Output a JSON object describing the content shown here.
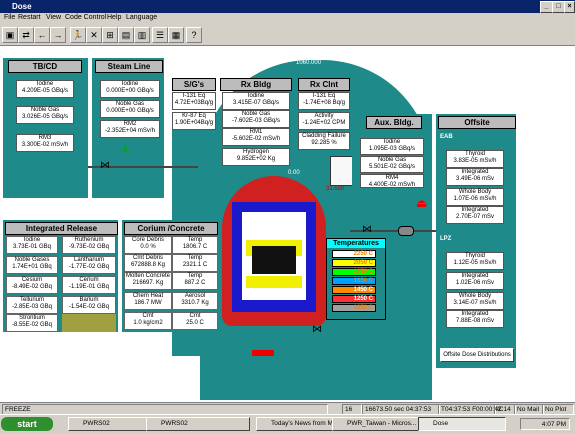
{
  "window": {
    "title": "Dose"
  },
  "menu": [
    "File",
    "Restart",
    "View",
    "Code Control",
    "Help",
    "Language"
  ],
  "diagram": {
    "top_value": "1060.000",
    "temp_value": "0.00",
    "tank_value": "31.590",
    "tbcd": {
      "title": "TB/CD",
      "items": [
        {
          "label": "Iodine",
          "value": "4.209E-05",
          "unit": "GBq/s"
        },
        {
          "label": "Noble Gas",
          "value": "3.026E-05",
          "unit": "GBq/s"
        },
        {
          "label": "RM3",
          "value": "3.300E-02",
          "unit": "mSv/h"
        }
      ]
    },
    "steam": {
      "title": "Steam Line",
      "items": [
        {
          "label": "Iodine",
          "value": "0.000E+00",
          "unit": "GBq/s"
        },
        {
          "label": "Noble Gas",
          "value": "0.000E+00",
          "unit": "GBq/s"
        },
        {
          "label": "RM2",
          "value": "-2.352E+04",
          "unit": "mSv/h"
        }
      ]
    },
    "sgs": {
      "title": "S/G's",
      "items": [
        {
          "label": "I-131 Eq",
          "value": "4.72E+03",
          "unit": "Bq/g"
        },
        {
          "label": "Kr-87 Eq",
          "value": "1.90E+04",
          "unit": "Bq/g"
        }
      ]
    },
    "rxbldg": {
      "title": "Rx Bldg",
      "items": [
        {
          "label": "Iodine",
          "value": "3.415E-07",
          "unit": "GBq/s"
        },
        {
          "label": "Noble Gas",
          "value": "-7.602E-03",
          "unit": "GBq/s"
        },
        {
          "label": "RM1",
          "value": "-5.602E-02",
          "unit": "mSv/h"
        },
        {
          "label": "Hydrogen",
          "value": "9.852E+02",
          "unit": "Kg"
        }
      ]
    },
    "rxclnt": {
      "title": "Rx Clnt",
      "items": [
        {
          "label": "I-131 Eq",
          "value": "-1.74E+08",
          "unit": "Bq/g"
        },
        {
          "label": "Activity",
          "value": "-1.24E+02",
          "unit": "CPM"
        },
        {
          "label": "Cladding Failure",
          "value": "92.285",
          "unit": "%"
        }
      ]
    },
    "aux": {
      "title": "Aux. Bldg.",
      "items": [
        {
          "label": "Iodine",
          "value": "1.095E-03",
          "unit": "GBq/s"
        },
        {
          "label": "Noble Gas",
          "value": "5.501E-02",
          "unit": "GBq/s"
        },
        {
          "label": "RM4",
          "value": "4.400E-02",
          "unit": "mSv/h"
        }
      ]
    },
    "offsite": {
      "title": "Offsite",
      "eab_label": "EAB",
      "lpz_label": "LPZ",
      "eab": [
        {
          "label": "Thyroid",
          "value": "3.83E-05",
          "unit": "mSv/h"
        },
        {
          "label": "Integrated",
          "value": "3.49E-06",
          "unit": "mSv"
        },
        {
          "label": "Whole Body",
          "value": "1.07E-06",
          "unit": "mSv/h"
        },
        {
          "label": "Integrated",
          "value": "2.70E-07",
          "unit": "mSv"
        }
      ],
      "lpz": [
        {
          "label": "Thyroid",
          "value": "1.12E-05",
          "unit": "mSv/h"
        },
        {
          "label": "Integrated",
          "value": "1.02E-06",
          "unit": "mSv"
        },
        {
          "label": "Whole Body",
          "value": "3.14E-07",
          "unit": "mSv/h"
        },
        {
          "label": "Integrated",
          "value": "7.88E-08",
          "unit": "mSv"
        }
      ],
      "distributions_button": "Offsite Dose Distributions"
    },
    "integrated": {
      "title": "Integrated Release",
      "items": [
        {
          "label": "Iodine",
          "value": "3.73E-01",
          "unit": "GBq"
        },
        {
          "label": "Ruthenium",
          "value": "-9.73E-02",
          "unit": "GBq"
        },
        {
          "label": "Noble Gases",
          "value": "1.74E+01",
          "unit": "GBq"
        },
        {
          "label": "Lanthanum",
          "value": "-1.77E-02",
          "unit": "GBq"
        },
        {
          "label": "Cesium",
          "value": "-8.49E-02",
          "unit": "GBq"
        },
        {
          "label": "Cerium",
          "value": "-1.19E-01",
          "unit": "GBq"
        },
        {
          "label": "Tellurium",
          "value": "-2.85E-03",
          "unit": "GBq"
        },
        {
          "label": "Barium",
          "value": "-1.54E-02",
          "unit": "GBq"
        },
        {
          "label": "Strontium",
          "value": "-8.55E-02",
          "unit": "GBq"
        }
      ]
    },
    "corium": {
      "title": "Corium /Concrete",
      "items": [
        {
          "label": "Core Debris",
          "value": "0.0",
          "unit": "%"
        },
        {
          "label": "Temp",
          "value": "1806.7",
          "unit": "C"
        },
        {
          "label": "Cmt Debris",
          "value": "672888.8",
          "unit": "Kg"
        },
        {
          "label": "Temp",
          "value": "2321.1",
          "unit": "C"
        },
        {
          "label": "Molten Concrete",
          "value": "216697.",
          "unit": "Kg"
        },
        {
          "label": "Temp",
          "value": "887.2",
          "unit": "C"
        },
        {
          "label": "Chem Heat",
          "value": "186.7",
          "unit": "MW"
        },
        {
          "label": "Aerosol",
          "value": "3310.7",
          "unit": "Kg"
        },
        {
          "label": "Cmt",
          "value": "1.0",
          "unit": "kg/cm2"
        },
        {
          "label": "Cmt",
          "value": "25.0",
          "unit": "C"
        }
      ]
    },
    "temps": {
      "title": "Temperatures",
      "rows": [
        {
          "value": "2250 C",
          "color": "#ffffff"
        },
        {
          "value": "2050 C",
          "color": "#ffff00"
        },
        {
          "value": "1850 C",
          "color": "#00ff00"
        },
        {
          "value": "1650 C",
          "color": "#00a0ff"
        },
        {
          "value": "1450 C",
          "color": "#ff8c00"
        },
        {
          "value": "1250 C",
          "color": "#ff3030"
        },
        {
          "value": "1050 C",
          "color": "#a0a0a0"
        }
      ]
    }
  },
  "status": {
    "mode": "FREEZE",
    "num": "16",
    "sim_time": "16673.50 sec 04:37:53",
    "clock": "T04:37:53 F00:00:42",
    "cell": "IC14",
    "mail": "No Mail",
    "plot": "No Plot"
  },
  "taskbar": {
    "start": "start",
    "tasks": [
      "PWRS02",
      "PWRS02",
      "Today's News from M...",
      "PWR_Taiwan - Micros...",
      "Dose"
    ],
    "time": "4:07 PM"
  },
  "colors": {
    "teal": "#1f8a8a",
    "title_bar": "#0a246a",
    "olive": "#a0a040"
  }
}
